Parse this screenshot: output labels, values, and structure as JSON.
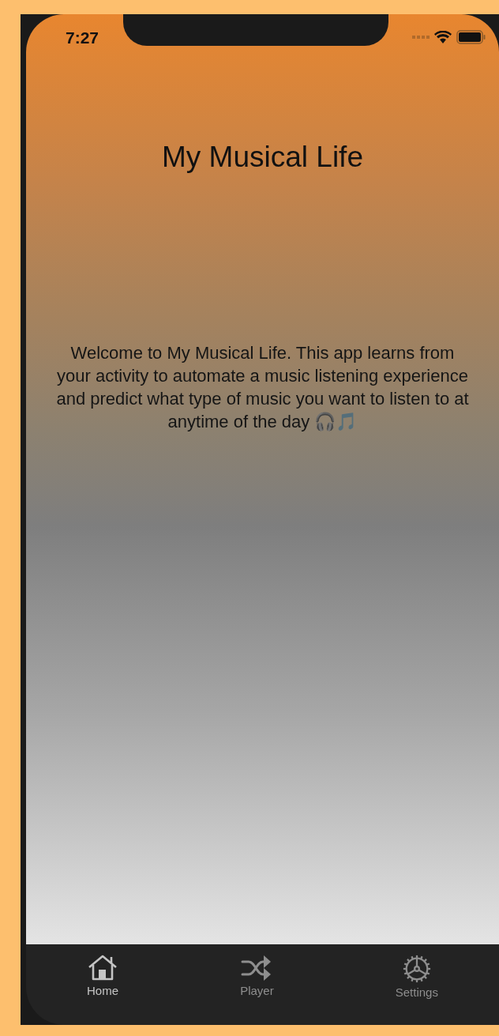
{
  "status_bar": {
    "time": "7:27"
  },
  "title": "My Musical Life",
  "welcome": "Welcome to My Musical Life. This app learns from your activity to automate a music listening experience and predict what type of music you want to listen to at anytime of the day 🎧🎵",
  "tabs": [
    {
      "label": "Home",
      "kind": "home",
      "selected": true
    },
    {
      "label": "Player",
      "kind": "shuffle",
      "selected": false
    },
    {
      "label": "Settings",
      "kind": "gear",
      "selected": false
    }
  ]
}
